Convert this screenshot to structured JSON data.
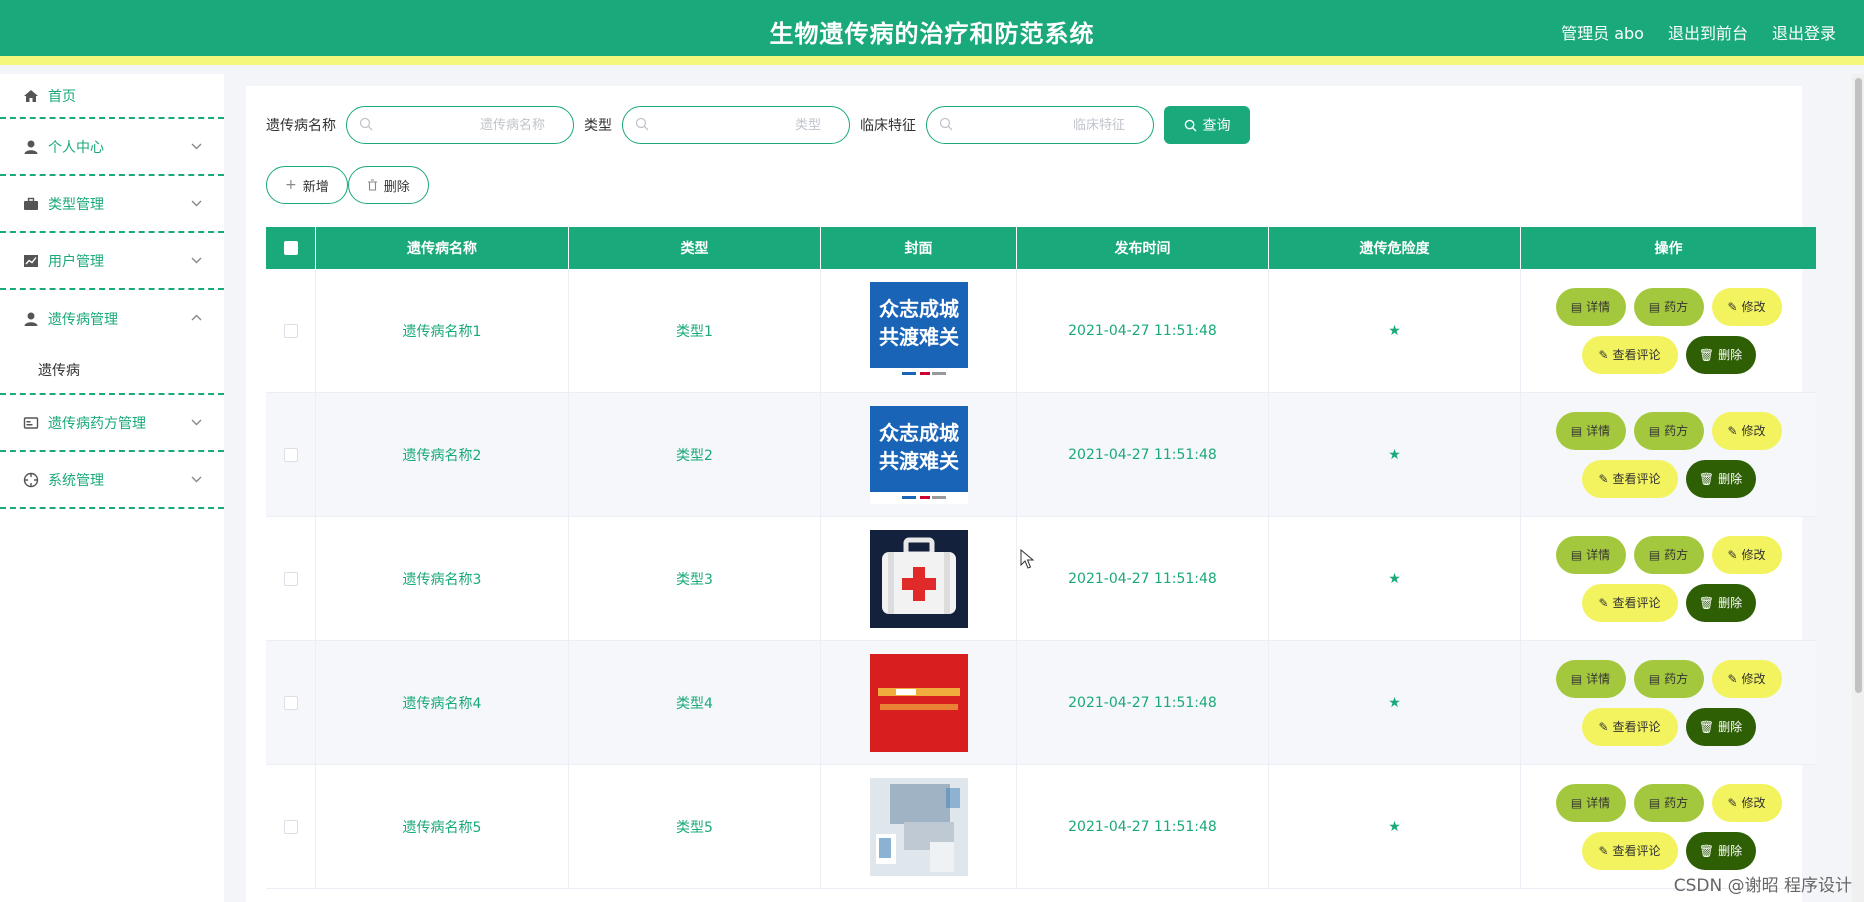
{
  "header": {
    "title": "生物遗传病的治疗和防范系统",
    "links": [
      "管理员 abo",
      "退出到前台",
      "退出登录"
    ]
  },
  "sidebar": {
    "items": [
      {
        "label": "首页",
        "icon": "home-icon"
      },
      {
        "label": "个人中心",
        "icon": "user-icon"
      },
      {
        "label": "类型管理",
        "icon": "briefcase-icon"
      },
      {
        "label": "用户管理",
        "icon": "chart-icon"
      },
      {
        "label": "遗传病管理",
        "icon": "user-icon",
        "expanded": true,
        "sub": [
          "遗传病"
        ]
      },
      {
        "label": "遗传病药方管理",
        "icon": "card-icon"
      },
      {
        "label": "系统管理",
        "icon": "target-icon"
      }
    ]
  },
  "search": {
    "fields": [
      {
        "label": "遗传病名称",
        "placeholder": "遗传病名称"
      },
      {
        "label": "类型",
        "placeholder": "类型"
      },
      {
        "label": "临床特征",
        "placeholder": "临床特征"
      }
    ],
    "query_label": "查询"
  },
  "actions": {
    "add_label": "新增",
    "delete_label": "删除"
  },
  "table": {
    "columns": [
      "遗传病名称",
      "类型",
      "封面",
      "发布时间",
      "遗传危险度",
      "操作"
    ],
    "rows": [
      {
        "name": "遗传病名称1",
        "type": "类型1",
        "time": "2021-04-27 11:51:48",
        "risk": "★",
        "cover": "slogan-cover"
      },
      {
        "name": "遗传病名称2",
        "type": "类型2",
        "time": "2021-04-27 11:51:48",
        "risk": "★",
        "cover": "slogan-cover"
      },
      {
        "name": "遗传病名称3",
        "type": "类型3",
        "time": "2021-04-27 11:51:48",
        "risk": "★",
        "cover": "first-aid-kit-cover"
      },
      {
        "name": "遗传病名称4",
        "type": "类型4",
        "time": "2021-04-27 11:51:48",
        "risk": "★",
        "cover": "red-banner-cover"
      },
      {
        "name": "遗传病名称5",
        "type": "类型5",
        "time": "2021-04-27 11:51:48",
        "risk": "★",
        "cover": "laptop-photo-cover"
      }
    ],
    "row_actions": {
      "detail": "详情",
      "recipe": "药方",
      "edit": "修改",
      "comment": "查看评论",
      "delete": "删除"
    }
  },
  "covers": {
    "slogan_line1": "众志成城",
    "slogan_line2": "共渡难关"
  },
  "watermark": "CSDN @谢昭  程序设计",
  "colors": {
    "primary": "#1aa97a",
    "accent_yellow": "#f5f77c",
    "olive": "#a4c83d",
    "dark_green": "#2e5f05"
  }
}
